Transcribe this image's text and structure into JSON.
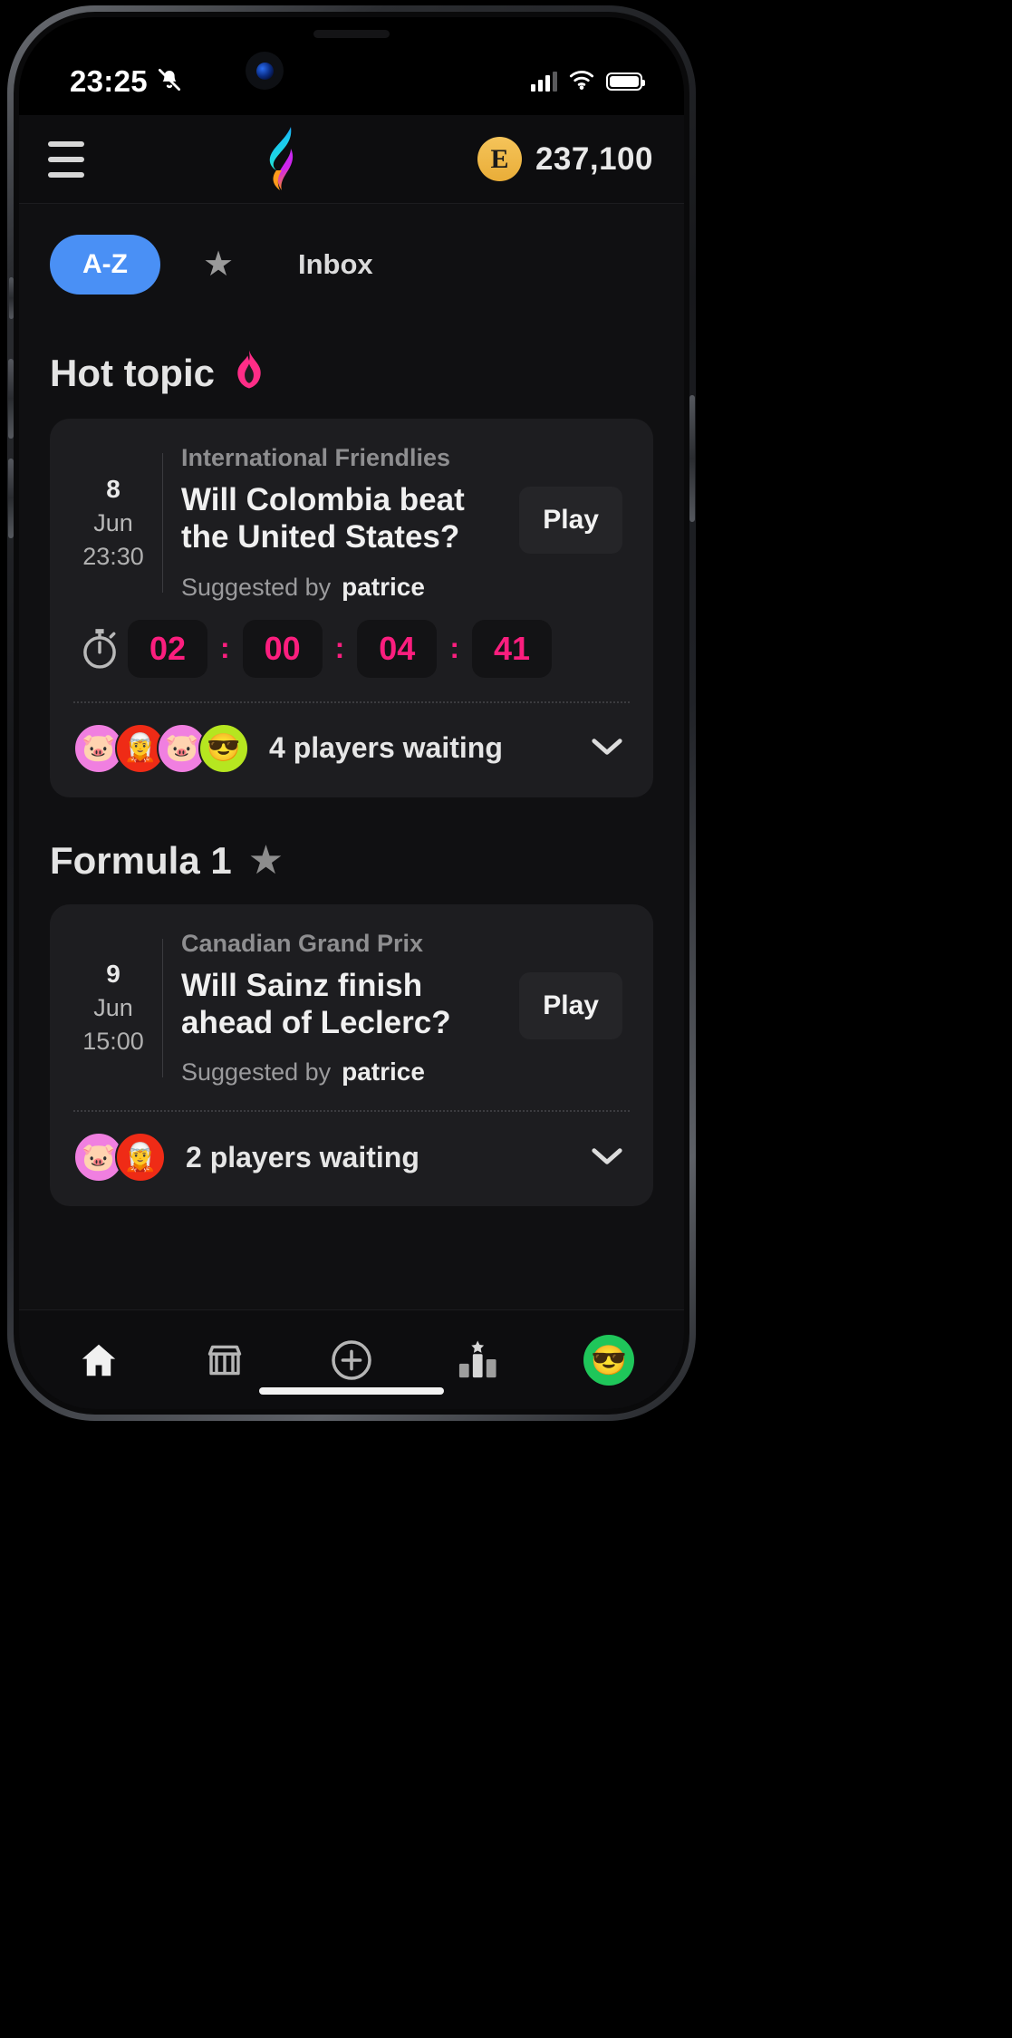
{
  "status_bar": {
    "time": "23:25",
    "silent_icon": "bell-slash-icon",
    "signal_icon": "cellular-signal-icon",
    "signal_bars_filled": 3,
    "wifi_icon": "wifi-icon",
    "battery_icon": "battery-full-icon"
  },
  "app_bar": {
    "menu_icon": "hamburger-menu-icon",
    "logo_icon": "app-flame-logo-icon",
    "coin_letter": "E",
    "points": "237,100"
  },
  "tabs": {
    "sort_label": "A-Z",
    "favorites_icon": "star-icon",
    "inbox_label": "Inbox"
  },
  "sections": [
    {
      "title": "Hot topic",
      "icon": "fire-icon",
      "icon_glyph": "🔥",
      "accent": "#ff2d87",
      "card": {
        "day": "8",
        "month": "Jun",
        "time": "23:30",
        "league": "International Friendlies",
        "question": "Will Colombia beat the United States?",
        "play_label": "Play",
        "suggested_prefix": "Suggested by",
        "suggested_by": "patrice",
        "has_timer": true,
        "timer": {
          "icon": "stopwatch-icon",
          "values": [
            "02",
            "00",
            "04",
            "41"
          ],
          "separator": ":",
          "color": "#fb1e7e"
        },
        "players_text": "4 players waiting",
        "players_count": 4,
        "avatars": [
          {
            "name": "avatar-player-1",
            "bg": "#f07fe0",
            "glyph": "🐷"
          },
          {
            "name": "avatar-player-2",
            "bg": "#ef2b16",
            "glyph": "🧝"
          },
          {
            "name": "avatar-player-3",
            "bg": "#f07fe0",
            "glyph": "🐷"
          },
          {
            "name": "avatar-player-4",
            "bg": "#b6e620",
            "glyph": "😎"
          }
        ],
        "expand_icon": "chevron-down-icon"
      }
    },
    {
      "title": "Formula 1",
      "icon": "star-icon",
      "icon_glyph": "★",
      "accent": "#8d8d8d",
      "card": {
        "day": "9",
        "month": "Jun",
        "time": "15:00",
        "league": "Canadian Grand Prix",
        "question": "Will Sainz finish ahead of Leclerc?",
        "play_label": "Play",
        "suggested_prefix": "Suggested by",
        "suggested_by": "patrice",
        "has_timer": false,
        "players_text": "2 players waiting",
        "players_count": 2,
        "avatars": [
          {
            "name": "avatar-player-1",
            "bg": "#f07fe0",
            "glyph": "🐷"
          },
          {
            "name": "avatar-player-2",
            "bg": "#ef2b16",
            "glyph": "🧝"
          }
        ],
        "expand_icon": "chevron-down-icon"
      }
    }
  ],
  "bottom_nav": [
    {
      "name": "nav-home",
      "icon": "home-icon",
      "active": true
    },
    {
      "name": "nav-store",
      "icon": "store-icon",
      "active": false
    },
    {
      "name": "nav-create",
      "icon": "plus-circle-icon",
      "active": false
    },
    {
      "name": "nav-leaderboard",
      "icon": "leaderboard-icon",
      "active": false
    },
    {
      "name": "nav-profile",
      "icon": "avatar-icon",
      "active": false
    }
  ],
  "colors": {
    "background": "#101012",
    "card": "#1d1d20",
    "accent_blue": "#4a90f5",
    "accent_pink": "#fb1e7e",
    "coin_gold": "#eeb541"
  }
}
